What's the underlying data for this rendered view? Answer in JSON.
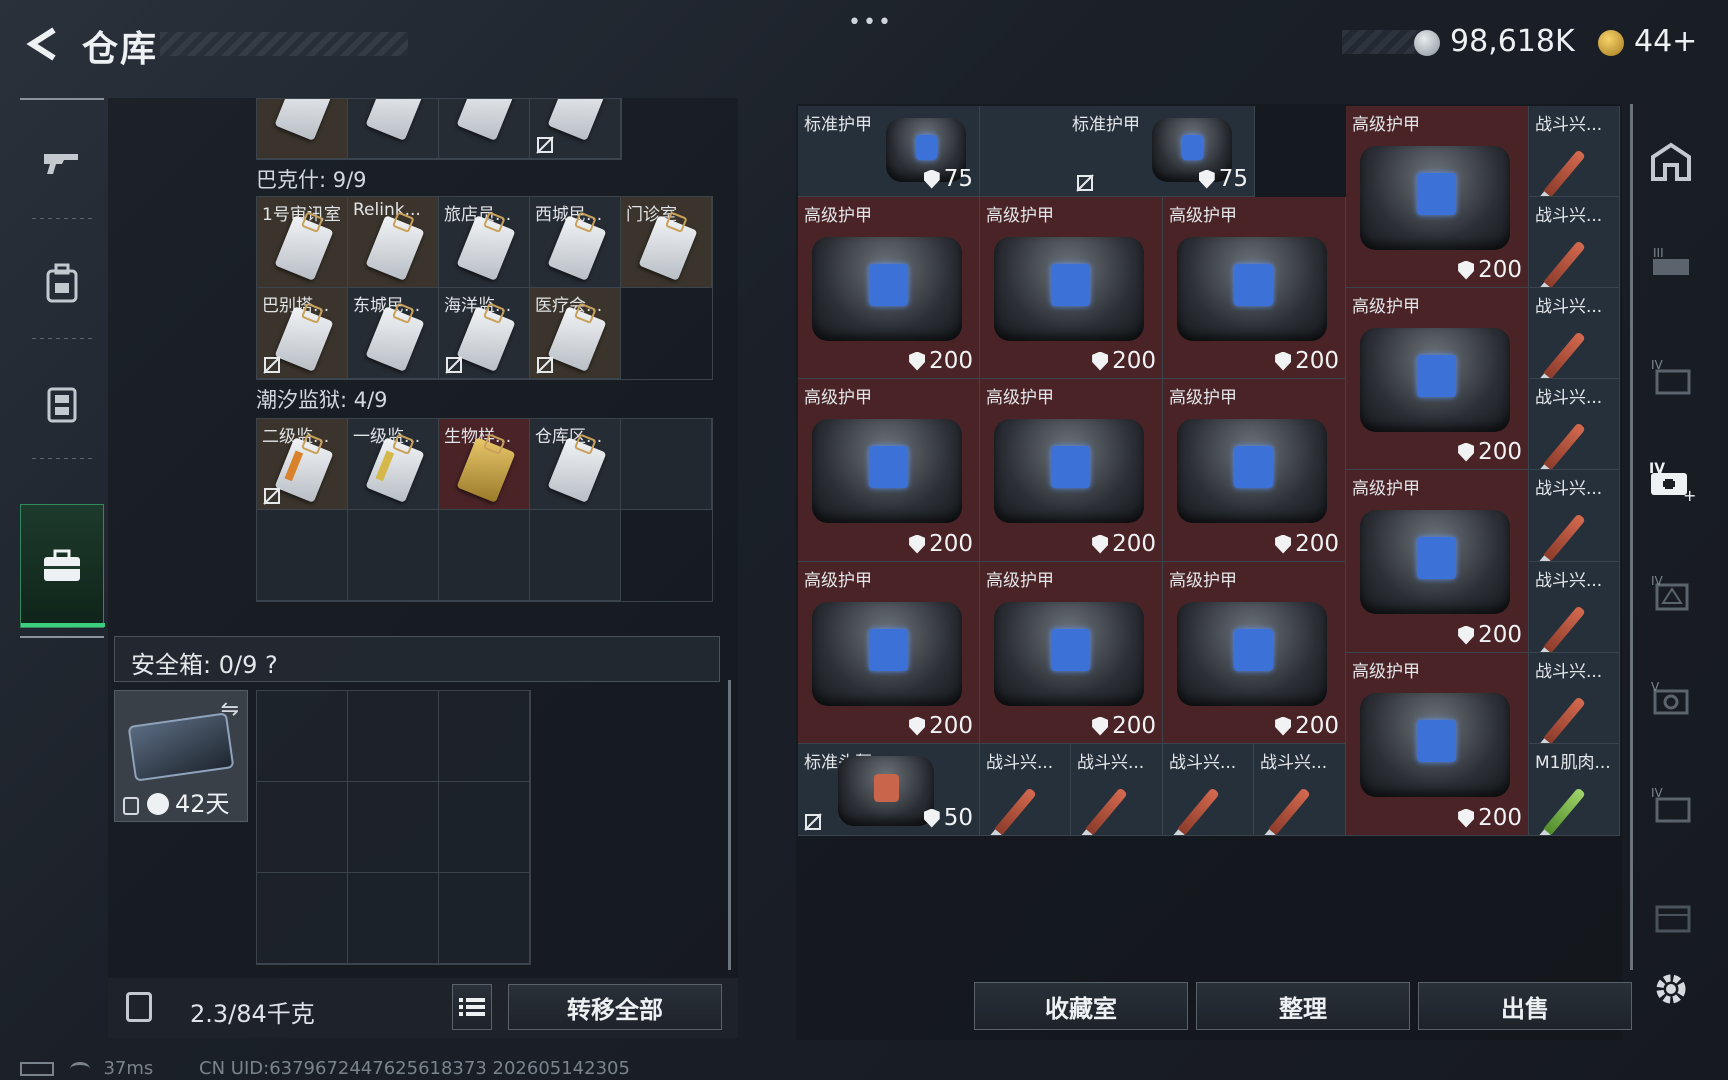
{
  "header": {
    "title": "仓库",
    "dots": "•••",
    "silver": "98,618K",
    "gold": "44+"
  },
  "rail": [
    "gun",
    "backpack",
    "vest",
    "toolbox"
  ],
  "left": {
    "sections": [
      {
        "label": "巴克什: 9/9",
        "items": [
          "1号审讯室",
          "Relink...",
          "旅店员...",
          "西城民...",
          "门诊室",
          "巴别塔...",
          "东城民...",
          "海洋监...",
          "医疗会..."
        ]
      },
      {
        "label": "潮汐监狱: 4/9",
        "items": [
          "二级监...",
          "一级监...",
          "生物样...",
          "仓库区..."
        ]
      }
    ],
    "safe_label": "安全箱: 0/9",
    "safe_help": "?",
    "safe_days": "42天",
    "weight": "2.3/84千克",
    "transfer_all": "转移全部"
  },
  "stash": {
    "std_armor": "标准护甲",
    "adv_armor": "高级护甲",
    "std_helmet": "标准头盔",
    "stim": "战斗兴...",
    "m1": "M1肌肉...",
    "v75": "75",
    "v200": "200",
    "v50": "50"
  },
  "footer": {
    "collection": "收藏室",
    "sort": "整理",
    "sell": "出售"
  },
  "status": {
    "ping": "37ms",
    "uid": "CN UID:6379672447625618373 202605142305"
  }
}
